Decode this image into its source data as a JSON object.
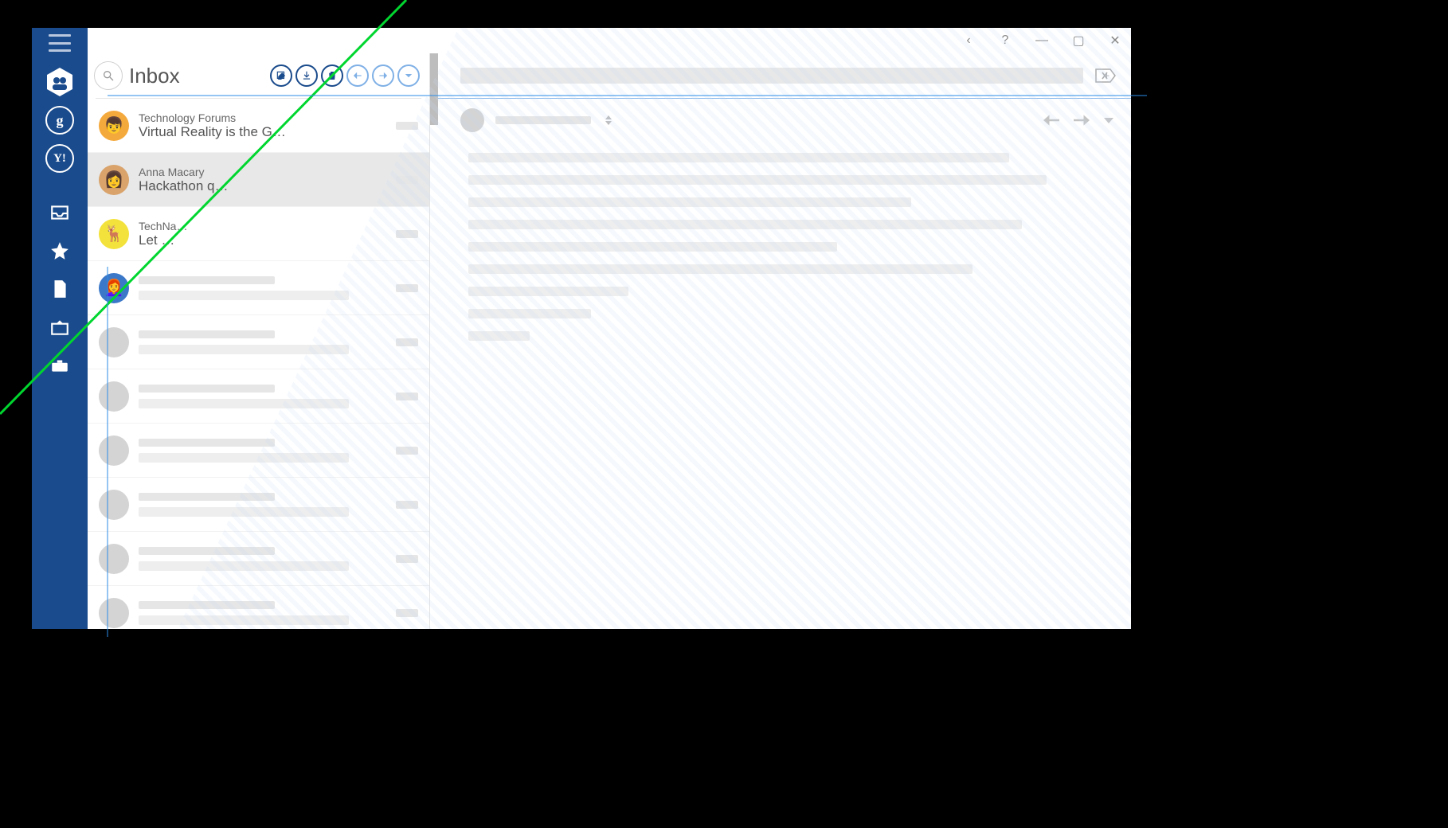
{
  "folder_title": "Inbox",
  "rail": {
    "accounts": [
      "all",
      "google",
      "yahoo"
    ],
    "nav": [
      "inbox",
      "starred",
      "drafts",
      "outbox",
      "tools"
    ]
  },
  "toolbar": {
    "compose": "compose",
    "download": "download",
    "delete": "delete",
    "reply": "reply",
    "forward": "forward",
    "more": "more"
  },
  "titlebar": {
    "back": "‹",
    "help": "?",
    "minimize": "—",
    "maximize": "▢",
    "close": "✕"
  },
  "messages": [
    {
      "from": "Technology Forums",
      "subject": "Virtual Reality is the G…",
      "avatar_bg": "#f4a93d",
      "avatar_emoji": "👦",
      "selected": false
    },
    {
      "from": "Anna Macary",
      "subject": "Hackathon q…",
      "avatar_bg": "#d9a36b",
      "avatar_emoji": "👩",
      "selected": true
    },
    {
      "from": "TechNa…",
      "subject": "Let …",
      "avatar_bg": "#f3e23b",
      "avatar_emoji": "🦌",
      "selected": false
    },
    {
      "from": "",
      "subject": "",
      "avatar_bg": "#3b78c8",
      "avatar_emoji": "👩‍🦰",
      "selected": false,
      "placeholder": true
    },
    {
      "from": "",
      "subject": "",
      "avatar_bg": "#d4d4d4",
      "avatar_emoji": "",
      "selected": false,
      "placeholder": true
    },
    {
      "from": "",
      "subject": "",
      "avatar_bg": "#d4d4d4",
      "avatar_emoji": "",
      "selected": false,
      "placeholder": true
    },
    {
      "from": "",
      "subject": "",
      "avatar_bg": "#d4d4d4",
      "avatar_emoji": "",
      "selected": false,
      "placeholder": true
    },
    {
      "from": "",
      "subject": "",
      "avatar_bg": "#d4d4d4",
      "avatar_emoji": "",
      "selected": false,
      "placeholder": true
    },
    {
      "from": "",
      "subject": "",
      "avatar_bg": "#d4d4d4",
      "avatar_emoji": "",
      "selected": false,
      "placeholder": true
    },
    {
      "from": "",
      "subject": "",
      "avatar_bg": "#d4d4d4",
      "avatar_emoji": "",
      "selected": false,
      "placeholder": true
    }
  ],
  "reader": {
    "body_line_widths": [
      88,
      94,
      72,
      90,
      60,
      82,
      26,
      20,
      10
    ]
  }
}
